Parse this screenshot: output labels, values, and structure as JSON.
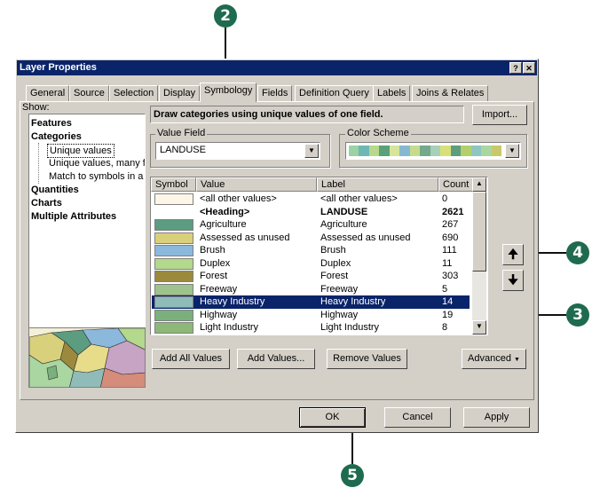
{
  "callouts": [
    "2",
    "3",
    "4",
    "5"
  ],
  "window": {
    "title": "Layer Properties",
    "help_btn": "?",
    "close_btn": "✕"
  },
  "tabs": [
    "General",
    "Source",
    "Selection",
    "Display",
    "Symbology",
    "Fields",
    "Definition Query",
    "Labels",
    "Joins & Relates"
  ],
  "show": {
    "label": "Show:",
    "items": [
      "Features",
      "Categories",
      "Unique values",
      "Unique values, many f",
      "Match to symbols in a",
      "Quantities",
      "Charts",
      "Multiple Attributes"
    ]
  },
  "description": "Draw categories using unique values of one field.",
  "import_btn": "Import...",
  "value_field": {
    "label": "Value Field",
    "value": "LANDUSE"
  },
  "color_scheme": {
    "label": "Color Scheme",
    "colors": [
      "#9bd3a4",
      "#6fb7b7",
      "#b8d88a",
      "#5aa17a",
      "#d6e59a",
      "#86b9d1",
      "#c6dc8c",
      "#73a98c",
      "#a6d0b8",
      "#d9e07a",
      "#5d9e7e",
      "#b4cf6a",
      "#8fc6c2",
      "#a9d6a1",
      "#c8c96b"
    ]
  },
  "table": {
    "headers": [
      "Symbol",
      "Value",
      "Label",
      "Count"
    ],
    "rows": [
      {
        "color": "#fdf6e8",
        "value": "<all other values>",
        "label": "<all other values>",
        "count": "0",
        "bold": false
      },
      {
        "color": "",
        "value": "<Heading>",
        "label": "LANDUSE",
        "count": "2621",
        "bold": true
      },
      {
        "color": "#5c9c80",
        "value": "Agriculture",
        "label": "Agriculture",
        "count": "267",
        "bold": false
      },
      {
        "color": "#d9d07c",
        "value": "Assessed as unused",
        "label": "Assessed as unused",
        "count": "690",
        "bold": false
      },
      {
        "color": "#8cb8dc",
        "value": "Brush",
        "label": "Brush",
        "count": "111",
        "bold": false
      },
      {
        "color": "#b4d88c",
        "value": "Duplex",
        "label": "Duplex",
        "count": "11",
        "bold": false
      },
      {
        "color": "#9b8a3e",
        "value": "Forest",
        "label": "Forest",
        "count": "303",
        "bold": false
      },
      {
        "color": "#9cc48c",
        "value": "Freeway",
        "label": "Freeway",
        "count": "5",
        "bold": false
      },
      {
        "color": "#8fbcb8",
        "value": "Heavy Industry",
        "label": "Heavy Industry",
        "count": "14",
        "bold": false
      },
      {
        "color": "#7ab07c",
        "value": "Highway",
        "label": "Highway",
        "count": "19",
        "bold": false
      },
      {
        "color": "#8eb878",
        "value": "Light Industry",
        "label": "Light Industry",
        "count": "8",
        "bold": false
      }
    ],
    "selected_index": 8
  },
  "buttons": {
    "add_all": "Add All Values",
    "add_values": "Add Values...",
    "remove_values": "Remove Values",
    "advanced": "Advanced",
    "ok": "OK",
    "cancel": "Cancel",
    "apply": "Apply"
  }
}
